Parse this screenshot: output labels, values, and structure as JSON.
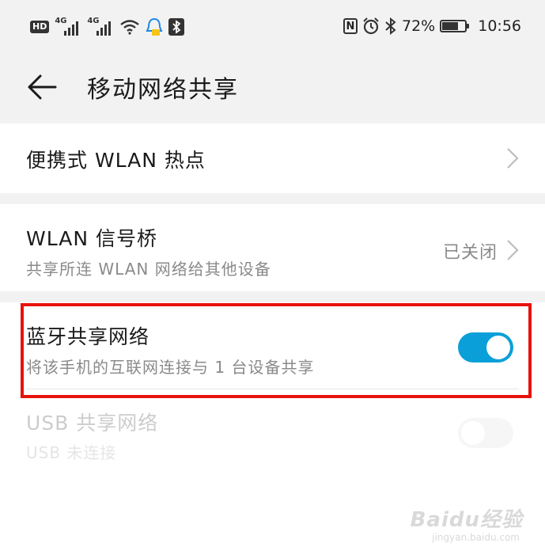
{
  "status_bar": {
    "hd_label": "HD",
    "signal1_gen": "4G",
    "signal2_gen": "4G",
    "nfc_label": "N",
    "battery": "72%",
    "battery_level": 0.72,
    "time": "10:56"
  },
  "header": {
    "title": "移动网络共享"
  },
  "items": {
    "hotspot": {
      "title": "便携式 WLAN 热点"
    },
    "wlan_bridge": {
      "title": "WLAN 信号桥",
      "subtitle": "共享所连 WLAN 网络给其他设备",
      "status": "已关闭"
    },
    "bt_tether": {
      "title": "蓝牙共享网络",
      "subtitle": "将该手机的互联网连接与 1 台设备共享",
      "enabled": true
    },
    "usb_tether": {
      "title": "USB 共享网络",
      "subtitle": "USB 未连接",
      "enabled": false
    }
  },
  "colors": {
    "accent": "#0a9fd8",
    "highlight_border": "#e8120c",
    "toggle_off": "#d8d8d8"
  },
  "watermark": {
    "logo": "Baidu经验",
    "url": "jingyan.baidu.com"
  }
}
